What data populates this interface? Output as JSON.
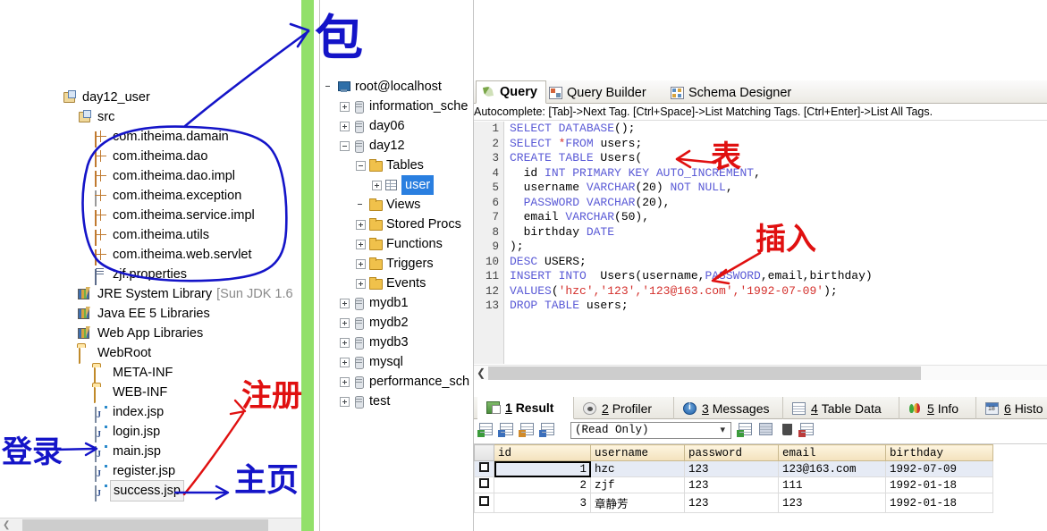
{
  "project_tree": {
    "items": [
      {
        "label": "day12_user",
        "icon": "java-project-icon",
        "indent": 0,
        "type": "project"
      },
      {
        "label": "src",
        "icon": "source-folder-icon",
        "indent": 1,
        "type": "srcfolder"
      },
      {
        "label": "com.itheima.damain",
        "icon": "package-icon",
        "indent": 2,
        "type": "package"
      },
      {
        "label": "com.itheima.dao",
        "icon": "package-icon",
        "indent": 2,
        "type": "package"
      },
      {
        "label": "com.itheima.dao.impl",
        "icon": "package-icon",
        "indent": 2,
        "type": "package"
      },
      {
        "label": "com.itheima.exception",
        "icon": "package-icon-empty",
        "indent": 2,
        "type": "package-empty"
      },
      {
        "label": "com.itheima.service.impl",
        "icon": "package-icon",
        "indent": 2,
        "type": "package"
      },
      {
        "label": "com.itheima.utils",
        "icon": "package-icon",
        "indent": 2,
        "type": "package"
      },
      {
        "label": "com.itheima.web.servlet",
        "icon": "package-icon",
        "indent": 2,
        "type": "package"
      },
      {
        "label": "zjf.properties",
        "icon": "properties-file-icon",
        "indent": 2,
        "type": "file"
      },
      {
        "label": "JRE System Library",
        "suffix": "[Sun JDK 1.6",
        "icon": "library-icon",
        "indent": 1,
        "type": "library"
      },
      {
        "label": "Java EE 5 Libraries",
        "icon": "library-icon",
        "indent": 1,
        "type": "library"
      },
      {
        "label": "Web App Libraries",
        "icon": "library-icon",
        "indent": 1,
        "type": "library"
      },
      {
        "label": "WebRoot",
        "icon": "folder-icon",
        "indent": 1,
        "type": "folder"
      },
      {
        "label": "META-INF",
        "icon": "folder-icon",
        "indent": 2,
        "type": "folder"
      },
      {
        "label": "WEB-INF",
        "icon": "folder-icon",
        "indent": 2,
        "type": "folder"
      },
      {
        "label": "index.jsp",
        "icon": "jsp-file-icon",
        "indent": 2,
        "type": "jsp"
      },
      {
        "label": "login.jsp",
        "icon": "jsp-file-icon",
        "indent": 2,
        "type": "jsp"
      },
      {
        "label": "main.jsp",
        "icon": "jsp-file-icon",
        "indent": 2,
        "type": "jsp"
      },
      {
        "label": "register.jsp",
        "icon": "jsp-file-icon",
        "indent": 2,
        "type": "jsp"
      },
      {
        "label": "success.jsp",
        "icon": "jsp-file-icon",
        "indent": 2,
        "type": "jsp",
        "selected": true
      }
    ]
  },
  "db_tree": {
    "items": [
      {
        "label": "root@localhost",
        "icon": "server-icon",
        "indent": 0,
        "expander": "none"
      },
      {
        "label": "information_sche",
        "icon": "database-icon",
        "indent": 1,
        "expander": "plus"
      },
      {
        "label": "day06",
        "icon": "database-icon",
        "indent": 1,
        "expander": "plus"
      },
      {
        "label": "day12",
        "icon": "database-icon",
        "indent": 1,
        "expander": "minus"
      },
      {
        "label": "Tables",
        "icon": "folder-icon",
        "indent": 2,
        "expander": "minus"
      },
      {
        "label": "user",
        "icon": "table-icon",
        "indent": 3,
        "expander": "plus",
        "selected": true
      },
      {
        "label": "Views",
        "icon": "folder-icon",
        "indent": 2,
        "expander": "none"
      },
      {
        "label": "Stored Procs",
        "icon": "folder-icon",
        "indent": 2,
        "expander": "plus"
      },
      {
        "label": "Functions",
        "icon": "folder-icon",
        "indent": 2,
        "expander": "plus"
      },
      {
        "label": "Triggers",
        "icon": "folder-icon",
        "indent": 2,
        "expander": "plus"
      },
      {
        "label": "Events",
        "icon": "folder-icon",
        "indent": 2,
        "expander": "plus"
      },
      {
        "label": "mydb1",
        "icon": "database-icon",
        "indent": 1,
        "expander": "plus"
      },
      {
        "label": "mydb2",
        "icon": "database-icon",
        "indent": 1,
        "expander": "plus"
      },
      {
        "label": "mydb3",
        "icon": "database-icon",
        "indent": 1,
        "expander": "plus"
      },
      {
        "label": "mysql",
        "icon": "database-icon",
        "indent": 1,
        "expander": "plus"
      },
      {
        "label": "performance_sch",
        "icon": "database-icon",
        "indent": 1,
        "expander": "plus"
      },
      {
        "label": "test",
        "icon": "database-icon",
        "indent": 1,
        "expander": "plus"
      }
    ]
  },
  "editor": {
    "tabs": [
      {
        "label": "Query",
        "icon": "query-icon",
        "active": true
      },
      {
        "label": "Query Builder",
        "icon": "query-builder-icon",
        "active": false
      },
      {
        "label": "Schema Designer",
        "icon": "schema-designer-icon",
        "active": false
      }
    ],
    "autocomplete_hint": "Autocomplete: [Tab]->Next Tag. [Ctrl+Space]->List Matching Tags. [Ctrl+Enter]->List All Tags.",
    "line_numbers": [
      "1",
      "2",
      "3",
      "4",
      "5",
      "6",
      "7",
      "8",
      "9",
      "10",
      "11",
      "12",
      "13"
    ],
    "code_lines": [
      [
        {
          "t": "SELECT DATABASE",
          "c": "kw"
        },
        {
          "t": "();",
          "c": "id"
        }
      ],
      [
        {
          "t": "SELECT ",
          "c": "kw"
        },
        {
          "t": "*",
          "c": "str"
        },
        {
          "t": "FROM ",
          "c": "kw"
        },
        {
          "t": "users;",
          "c": "id"
        }
      ],
      [
        {
          "t": "CREATE TABLE ",
          "c": "kw"
        },
        {
          "t": "Users(",
          "c": "id"
        }
      ],
      [
        {
          "t": "  id ",
          "c": "id"
        },
        {
          "t": "INT PRIMARY KEY AUTO_INCREMENT",
          "c": "kw"
        },
        {
          "t": ",",
          "c": "id"
        }
      ],
      [
        {
          "t": "  username ",
          "c": "id"
        },
        {
          "t": "VARCHAR",
          "c": "kw"
        },
        {
          "t": "(20) ",
          "c": "id"
        },
        {
          "t": "NOT NULL",
          "c": "kw"
        },
        {
          "t": ",",
          "c": "id"
        }
      ],
      [
        {
          "t": "  PASSWORD VARCHAR",
          "c": "kw"
        },
        {
          "t": "(20),",
          "c": "id"
        }
      ],
      [
        {
          "t": "  email ",
          "c": "id"
        },
        {
          "t": "VARCHAR",
          "c": "kw"
        },
        {
          "t": "(50),",
          "c": "id"
        }
      ],
      [
        {
          "t": "  birthday ",
          "c": "id"
        },
        {
          "t": "DATE",
          "c": "kw"
        }
      ],
      [
        {
          "t": ");",
          "c": "id"
        }
      ],
      [
        {
          "t": "DESC ",
          "c": "kw"
        },
        {
          "t": "USERS;",
          "c": "id"
        }
      ],
      [
        {
          "t": "INSERT INTO  ",
          "c": "kw"
        },
        {
          "t": "Users(username,",
          "c": "id"
        },
        {
          "t": "PASSWORD",
          "c": "kw"
        },
        {
          "t": ",email,birthday)",
          "c": "id"
        }
      ],
      [
        {
          "t": "VALUES",
          "c": "kw"
        },
        {
          "t": "(",
          "c": "id"
        },
        {
          "t": "'hzc','123','123@163.com','1992-07-09'",
          "c": "str"
        },
        {
          "t": ");",
          "c": "id"
        }
      ],
      [
        {
          "t": "DROP TABLE ",
          "c": "kw"
        },
        {
          "t": "users;",
          "c": "id"
        }
      ]
    ]
  },
  "result_panel": {
    "tabs": [
      {
        "num": "1",
        "label": "Result",
        "icon": "result-grid-icon",
        "active": true
      },
      {
        "num": "2",
        "label": "Profiler",
        "icon": "profiler-icon",
        "active": false
      },
      {
        "num": "3",
        "label": "Messages",
        "icon": "messages-icon",
        "active": false
      },
      {
        "num": "4",
        "label": "Table Data",
        "icon": "table-data-icon",
        "active": false
      },
      {
        "num": "5",
        "label": "Info",
        "icon": "info-icon",
        "active": false
      },
      {
        "num": "6",
        "label": "Histo",
        "icon": "history-icon",
        "active": false
      }
    ],
    "mode_select_value": "(Read Only)",
    "toolbar_icons": [
      "new-record-icon",
      "apply-changes-icon",
      "export-grid-icon",
      "refresh-grid-icon",
      "post-edit-icon",
      "save-row-icon",
      "delete-row-icon",
      "duplicate-row-icon"
    ],
    "grid": {
      "columns": [
        "id",
        "username",
        "password",
        "email",
        "birthday"
      ],
      "rows": [
        {
          "id": "1",
          "username": "hzc",
          "password": "123",
          "email": "123@163.com",
          "birthday": "1992-07-09"
        },
        {
          "id": "2",
          "username": "zjf",
          "password": "123",
          "email": "111",
          "birthday": "1992-01-18"
        },
        {
          "id": "3",
          "username": "章静芳",
          "password": "123",
          "email": "123",
          "birthday": "1992-01-18"
        }
      ]
    }
  },
  "annotations": [
    {
      "id": "ann-package",
      "text": "包",
      "color": "#1414c8",
      "note": "blue, top center, points to package list"
    },
    {
      "id": "ann-register",
      "text": "注册",
      "color": "#e01010",
      "note": "red, points to register.jsp"
    },
    {
      "id": "ann-homepage",
      "text": "主页",
      "color": "#1414c8",
      "note": "blue, points to main.jsp"
    },
    {
      "id": "ann-login",
      "text": "登录",
      "color": "#1414c8",
      "note": "blue, points to login.jsp"
    },
    {
      "id": "ann-table",
      "text": "表",
      "color": "#e01010",
      "note": "red, points to CREATE TABLE Users("
    },
    {
      "id": "ann-insert",
      "text": "插入",
      "color": "#e01010",
      "note": "red, points to INSERT INTO"
    }
  ],
  "colors": {
    "sql_keyword": "#5a5ad6",
    "sql_string": "#d4302c",
    "selection_blue": "#2a7fe0",
    "overview_green": "#92e06a",
    "grid_header": "#f3e2bd"
  }
}
